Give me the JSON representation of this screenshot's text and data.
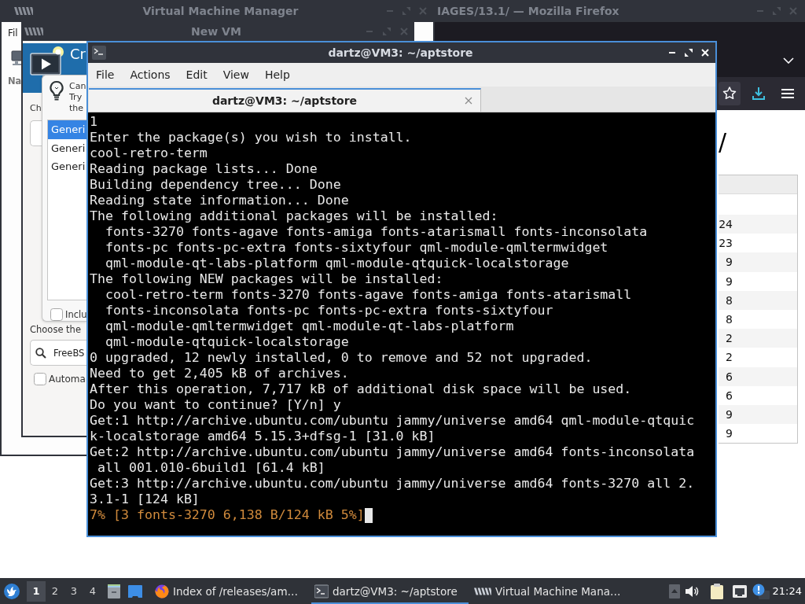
{
  "browser": {
    "active": false,
    "title": "IAGES/13.1/ — Mozilla Firefox",
    "heading": "/",
    "table_rows": [
      "24",
      "23",
      "9",
      "9",
      "8",
      "8",
      "2",
      "2",
      "6",
      "6",
      "9",
      "9"
    ]
  },
  "vmm": {
    "active": false,
    "title": "Virtual Machine Manager",
    "menu": [
      "Fil"
    ],
    "column_header": "Na"
  },
  "new_vm": {
    "active": false,
    "title": "New VM",
    "header_title": "Cr",
    "form_label": "Ch",
    "hint_lines": [
      "Can",
      "Try",
      "the"
    ],
    "os_list": [
      {
        "label": "Generi",
        "selected": true
      },
      {
        "label": "Generi",
        "selected": false
      },
      {
        "label": "Generi",
        "selected": false
      }
    ],
    "include_checkbox": {
      "label": "Inclu",
      "checked": false
    },
    "choose_label": "Choose the",
    "search": {
      "value": "FreeBS"
    },
    "auto_checkbox": {
      "label": "Automa",
      "checked": false
    }
  },
  "terminal": {
    "active": true,
    "title": "dartz@VM3: ~/aptstore",
    "menu": [
      "File",
      "Actions",
      "Edit",
      "View",
      "Help"
    ],
    "tabs": [
      {
        "label": "dartz@VM3: ~/aptstore",
        "selected": true
      }
    ],
    "cursor": true,
    "lines": [
      {
        "kind": "output",
        "text": "1"
      },
      {
        "kind": "output",
        "text": "Enter the package(s) you wish to install."
      },
      {
        "kind": "output",
        "text": "cool-retro-term"
      },
      {
        "kind": "output",
        "text": "Reading package lists... Done"
      },
      {
        "kind": "output",
        "text": "Building dependency tree... Done"
      },
      {
        "kind": "output",
        "text": "Reading state information... Done"
      },
      {
        "kind": "output",
        "text": "The following additional packages will be installed:"
      },
      {
        "kind": "output",
        "text": "  fonts-3270 fonts-agave fonts-amiga fonts-atarismall fonts-inconsolata"
      },
      {
        "kind": "output",
        "text": "  fonts-pc fonts-pc-extra fonts-sixtyfour qml-module-qmltermwidget"
      },
      {
        "kind": "output",
        "text": "  qml-module-qt-labs-platform qml-module-qtquick-localstorage"
      },
      {
        "kind": "output",
        "text": "The following NEW packages will be installed:"
      },
      {
        "kind": "output",
        "text": "  cool-retro-term fonts-3270 fonts-agave fonts-amiga fonts-atarismall"
      },
      {
        "kind": "output",
        "text": "  fonts-inconsolata fonts-pc fonts-pc-extra fonts-sixtyfour"
      },
      {
        "kind": "output",
        "text": "  qml-module-qmltermwidget qml-module-qt-labs-platform"
      },
      {
        "kind": "output",
        "text": "  qml-module-qtquick-localstorage"
      },
      {
        "kind": "output",
        "text": "0 upgraded, 12 newly installed, 0 to remove and 52 not upgraded."
      },
      {
        "kind": "output",
        "text": "Need to get 2,405 kB of archives."
      },
      {
        "kind": "output",
        "text": "After this operation, 7,717 kB of additional disk space will be used."
      },
      {
        "kind": "output",
        "text": "Do you want to continue? [Y/n] y"
      },
      {
        "kind": "output",
        "text": "Get:1 http://archive.ubuntu.com/ubuntu jammy/universe amd64 qml-module-qtquic"
      },
      {
        "kind": "output",
        "text": "k-localstorage amd64 5.15.3+dfsg-1 [31.0 kB]"
      },
      {
        "kind": "output",
        "text": "Get:2 http://archive.ubuntu.com/ubuntu jammy/universe amd64 fonts-inconsolata"
      },
      {
        "kind": "output",
        "text": " all 001.010-6build1 [61.4 kB]"
      },
      {
        "kind": "output",
        "text": "Get:3 http://archive.ubuntu.com/ubuntu jammy/universe amd64 fonts-3270 all 2."
      },
      {
        "kind": "output",
        "text": "3.1-1 [124 kB]"
      },
      {
        "kind": "progress",
        "text": "7% [3 fonts-3270 6,138 B/124 kB 5%]"
      }
    ]
  },
  "taskbar": {
    "workspaces": [
      {
        "label": "1",
        "selected": true
      },
      {
        "label": "2",
        "selected": false
      },
      {
        "label": "3",
        "selected": false
      },
      {
        "label": "4",
        "selected": false
      }
    ],
    "tasks": [
      {
        "kind": "browser",
        "label": "Index of /releases/am…",
        "selected": false
      },
      {
        "kind": "terminal",
        "label": "dartz@VM3: ~/aptstore",
        "selected": true
      },
      {
        "kind": "vm-manager",
        "label": "Virtual Machine Mana…",
        "selected": false
      }
    ],
    "clock": "21:24"
  }
}
